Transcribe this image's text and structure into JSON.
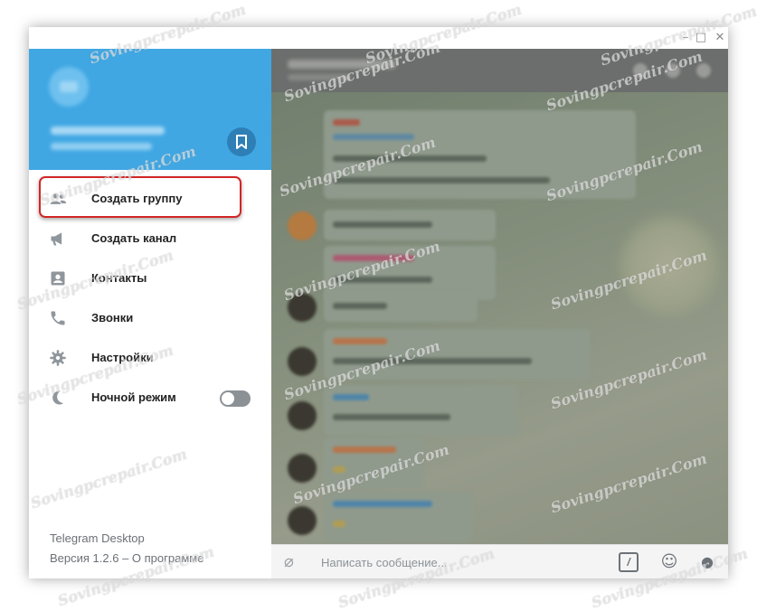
{
  "window": {
    "controls": {
      "minimize": "–",
      "maximize": "□",
      "close": "✕"
    }
  },
  "sidebar": {
    "menu": [
      {
        "label": "Создать группу",
        "icon": "group-icon"
      },
      {
        "label": "Создать канал",
        "icon": "megaphone-icon"
      },
      {
        "label": "Контакты",
        "icon": "contacts-icon"
      },
      {
        "label": "Звонки",
        "icon": "phone-icon"
      },
      {
        "label": "Настройки",
        "icon": "gear-icon"
      },
      {
        "label": "Ночной режим",
        "icon": "moon-icon",
        "toggle": "off"
      }
    ],
    "footer": {
      "app_name": "Telegram Desktop",
      "version": "Версия 1.2.6 – О программе"
    }
  },
  "chat": {
    "composer": {
      "placeholder": "Написать сообщение..."
    }
  },
  "watermark": "Sovingpcrepair.Com",
  "colors": {
    "profile_bg": "#40a7e3",
    "highlight_border": "#d22626"
  }
}
